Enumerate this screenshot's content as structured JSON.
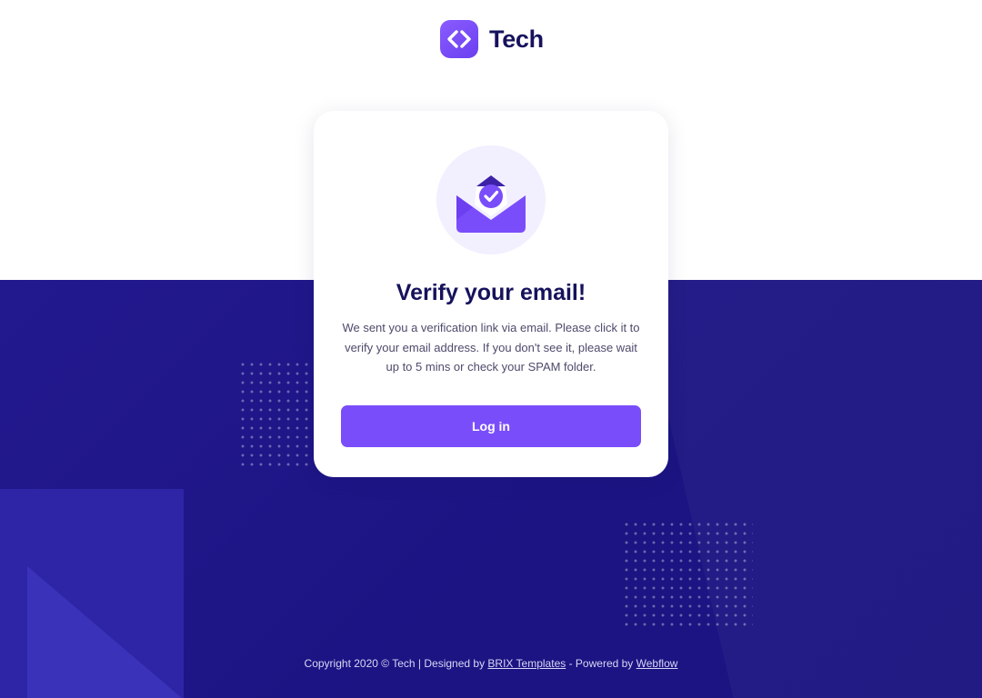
{
  "brand": {
    "name": "Tech",
    "logo_icon": "code-brackets-icon",
    "accent_color": "#7a4dfb"
  },
  "card": {
    "icon": "envelope-check-icon",
    "title": "Verify your email!",
    "message": "We sent you a verification link via email. Please click it to verify your email address. If you don't see it, please wait up to 5 mins or check your SPAM folder.",
    "button_label": "Log in"
  },
  "footer": {
    "copyright": "Copyright 2020 © Tech | Designed by",
    "designer_link": "BRIX Templates",
    "powered_text": "- Powered by",
    "powered_link": "Webflow"
  },
  "colors": {
    "navy_text": "#16125c",
    "background_dark": "#1c1483",
    "icon_bg": "#f2efff"
  }
}
